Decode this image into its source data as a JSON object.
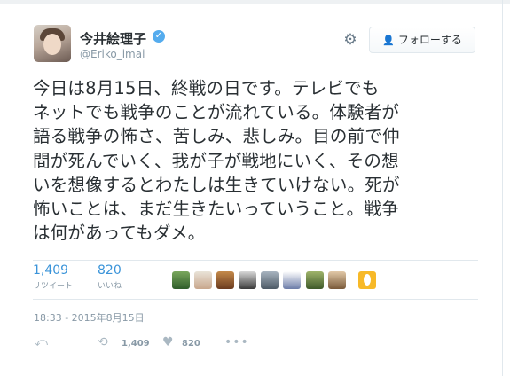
{
  "user": {
    "display_name": "今井絵理子",
    "handle": "@Eriko_imai",
    "verified": true
  },
  "follow_button": {
    "icon": "add-user-icon",
    "label": "フォローする"
  },
  "settings_icon": "gear-icon",
  "tweet_lines": [
    "今日は8月15日、終戦の日です。テレビでも",
    "ネットでも戦争のことが流れている。体験者が",
    "語る戦争の怖さ、苦しみ、悲しみ。目の前で仲",
    "間が死んでいく、我が子が戦地にいく、その想",
    "いを想像するとわたしは生きていけない。死が",
    "怖いことは、まだ生きたいっていうこと。戦争",
    "は何があってもダメ。"
  ],
  "stats": {
    "retweets": {
      "count": "1,409",
      "label": "リツイート"
    },
    "likes": {
      "count": "820",
      "label": "いいね"
    }
  },
  "liker_avatars": [
    "avatar-1",
    "avatar-2",
    "avatar-3",
    "avatar-4",
    "avatar-5",
    "avatar-6",
    "avatar-7",
    "avatar-8",
    "avatar-9"
  ],
  "timestamp": "18:33 - 2015年8月15日",
  "actions": {
    "reply_icon": "reply-icon",
    "retweet_icon": "retweet-icon",
    "retweet_count": "1,409",
    "like_icon": "heart-icon",
    "like_count": "820",
    "more_icon": "more-icon"
  },
  "colors": {
    "link": "#3b94d9",
    "verified": "#55acee",
    "muted": "#8899a6"
  }
}
